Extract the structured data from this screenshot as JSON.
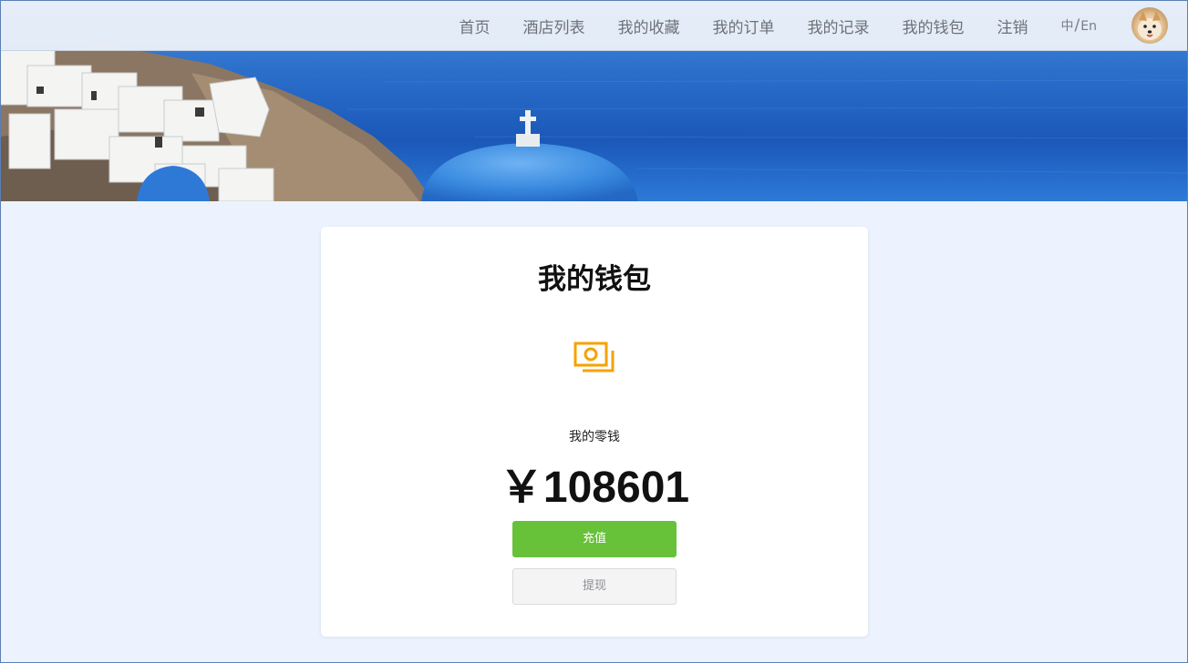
{
  "nav": {
    "items": [
      {
        "label": "首页"
      },
      {
        "label": "酒店列表"
      },
      {
        "label": "我的收藏"
      },
      {
        "label": "我的订单"
      },
      {
        "label": "我的记录"
      },
      {
        "label": "我的钱包"
      },
      {
        "label": "注销"
      }
    ],
    "lang_zh": "中",
    "lang_sep": "/",
    "lang_en": "En"
  },
  "wallet": {
    "title": "我的钱包",
    "balance_label": "我的零钱",
    "balance_amount": "￥108601",
    "recharge_label": "充值",
    "withdraw_label": "提现",
    "icon": "money-icon"
  },
  "colors": {
    "page_bg": "#ecf3fe",
    "accent_icon": "#f5a201",
    "recharge": "#67c23a"
  }
}
